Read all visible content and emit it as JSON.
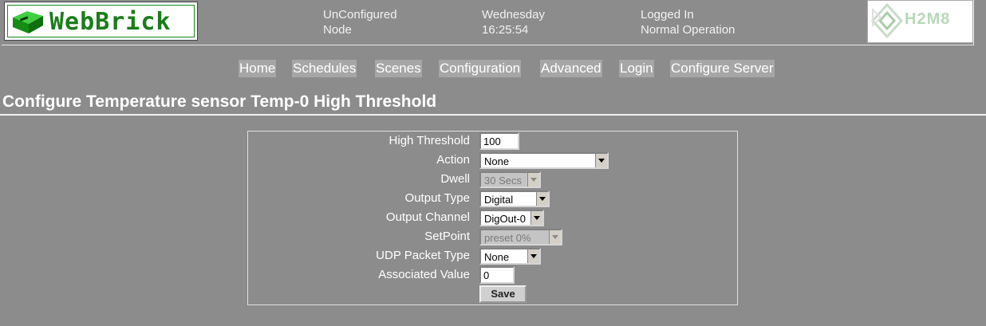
{
  "header": {
    "logo_text": "WebBrick",
    "node_status_line1": "UnConfigured",
    "node_status_line2": "Node",
    "day": "Wednesday",
    "time": "16:25:54",
    "login_status": "Logged In",
    "operation_status": "Normal Operation",
    "brand_logo_text": "H2M8"
  },
  "nav": {
    "items": [
      {
        "label": "Home"
      },
      {
        "label": "Schedules"
      },
      {
        "label": "Scenes"
      },
      {
        "label": "Configuration"
      },
      {
        "label": "Advanced"
      },
      {
        "label": "Login"
      },
      {
        "label": "Configure Server"
      }
    ]
  },
  "page": {
    "title": "Configure Temperature sensor Temp-0 High Threshold"
  },
  "form": {
    "high_threshold": {
      "label": "High Threshold",
      "value": "100"
    },
    "action": {
      "label": "Action",
      "selected": "None"
    },
    "dwell": {
      "label": "Dwell",
      "selected": "30 Secs"
    },
    "output_type": {
      "label": "Output Type",
      "selected": "Digital"
    },
    "output_channel": {
      "label": "Output Channel",
      "selected": "DigOut-0"
    },
    "setpoint": {
      "label": "SetPoint",
      "selected": "preset 0%"
    },
    "udp_packet_type": {
      "label": "UDP Packet Type",
      "selected": "None"
    },
    "associated_value": {
      "label": "Associated Value",
      "value": "0"
    },
    "save_label": "Save"
  },
  "colors": {
    "background": "#8c8c8c",
    "nav_button": "#a6a6a6",
    "logo_green": "#1a7d1a"
  }
}
